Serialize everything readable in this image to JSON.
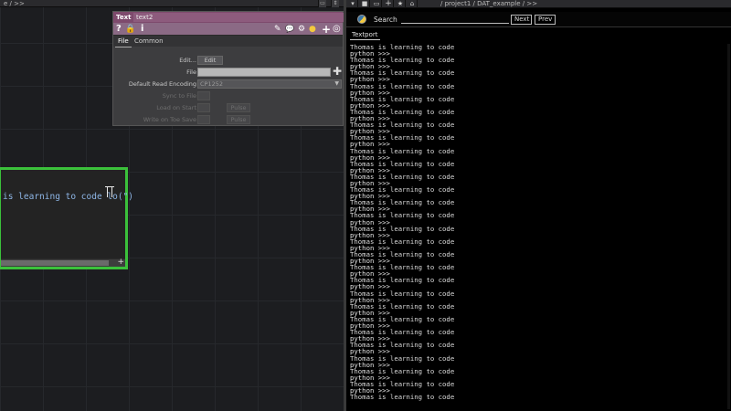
{
  "network": {
    "breadcrumb": "e / >>",
    "topbar_buttons": [
      "▭",
      "⇕"
    ]
  },
  "param_window": {
    "op_type": "Text",
    "op_name": "text2",
    "icons": [
      "?",
      "🔒",
      "i",
      "✎",
      "💬",
      "⚙",
      "●",
      "+",
      "◎"
    ],
    "tabs": [
      "File",
      "Common"
    ],
    "rows": {
      "edit": {
        "label": "Edit...",
        "button": "Edit"
      },
      "file": {
        "label": "File",
        "value": ""
      },
      "encoding": {
        "label": "Default Read Encoding",
        "value": "CP1252"
      },
      "sync": {
        "label": "Sync to File"
      },
      "load_on_start": {
        "label": "Load on Start",
        "button": "Pulse"
      },
      "write_on_save": {
        "label": "Write on Toe Save",
        "button": "Pulse"
      }
    }
  },
  "dat_viewer": {
    "text": "is learning to code lo(\")",
    "plus": "+"
  },
  "textport_pane": {
    "toolbar_icons": [
      "▾",
      "■",
      "▭",
      "+",
      "★",
      "⌂"
    ],
    "breadcrumb": "/ project1 / DAT_example / >>",
    "search": {
      "label": "Search",
      "value": "",
      "next": "Next",
      "prev": "Prev"
    },
    "tab": "Textport",
    "lines": [
      "Thomas is learning to code",
      "python >>>",
      "Thomas is learning to code",
      "python >>>",
      "Thomas is learning to code",
      "python >>>",
      "Thomas is learning to code",
      "python >>>",
      "Thomas is learning to code",
      "python >>>",
      "Thomas is learning to code",
      "python >>>",
      "Thomas is learning to code",
      "python >>>",
      "Thomas is learning to code",
      "python >>>",
      "Thomas is learning to code",
      "python >>>",
      "Thomas is learning to code",
      "python >>>",
      "Thomas is learning to code",
      "python >>>",
      "Thomas is learning to code",
      "python >>>",
      "Thomas is learning to code",
      "python >>>",
      "Thomas is learning to code",
      "python >>>",
      "Thomas is learning to code",
      "python >>>",
      "Thomas is learning to code",
      "python >>>",
      "Thomas is learning to code",
      "python >>>",
      "Thomas is learning to code",
      "python >>>",
      "Thomas is learning to code",
      "python >>>",
      "Thomas is learning to code",
      "python >>>",
      "Thomas is learning to code",
      "python >>>",
      "Thomas is learning to code",
      "python >>>",
      "Thomas is learning to code",
      "python >>>",
      "Thomas is learning to code",
      "python >>>",
      "Thomas is learning to code",
      "python >>>",
      "Thomas is learning to code",
      "python >>>",
      "Thomas is learning to code",
      "python >>>",
      "Thomas is learning to code"
    ]
  }
}
